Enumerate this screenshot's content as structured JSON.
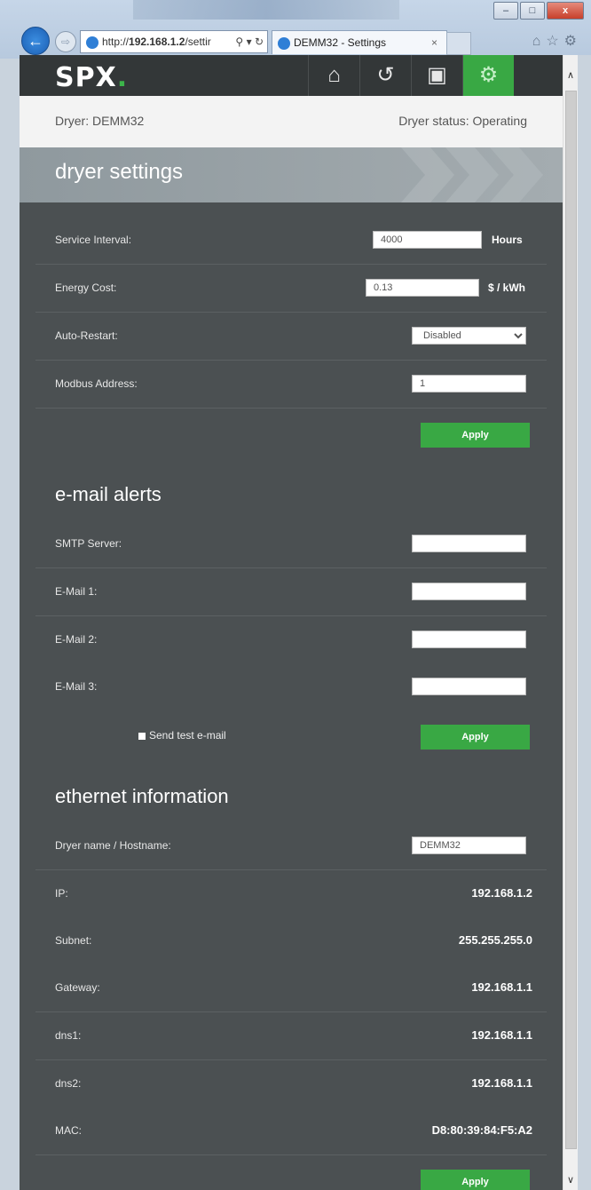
{
  "browser": {
    "url": "http://192.168.1.2/settir",
    "url_prefix": "http://",
    "url_host": "192.168.1.2",
    "url_path": "/settir",
    "tab_title": "DEMM32 - Settings",
    "tab_close": "×",
    "minimize": "–",
    "maximize": "□",
    "close": "x"
  },
  "app": {
    "logo": "SPX",
    "logo_dot": ".",
    "nav_icons": [
      "home-icon",
      "history-icon",
      "calendar-icon",
      "gear-icon"
    ],
    "accent": "#39a844"
  },
  "status": {
    "dryer_label": "Dryer: DEMM32",
    "status_label": "Dryer status: Operating"
  },
  "dryer_settings": {
    "title": "dryer settings",
    "service_interval": {
      "label": "Service Interval:",
      "value": "4000",
      "unit": "Hours"
    },
    "energy_cost": {
      "label": "Energy Cost:",
      "value": "0.13",
      "unit": "$ / kWh"
    },
    "auto_restart": {
      "label": "Auto-Restart:",
      "value": "Disabled"
    },
    "modbus_address": {
      "label": "Modbus Address:",
      "value": "1"
    },
    "apply": "Apply"
  },
  "email_alerts": {
    "title": "e-mail alerts",
    "smtp": {
      "label": "SMTP Server:",
      "value": ""
    },
    "email1": {
      "label": "E-Mail 1:",
      "value": ""
    },
    "email2": {
      "label": "E-Mail 2:",
      "value": ""
    },
    "email3": {
      "label": "E-Mail 3:",
      "value": ""
    },
    "send_test": "Send test e-mail",
    "apply": "Apply"
  },
  "ethernet": {
    "title": "ethernet information",
    "hostname": {
      "label": "Dryer name / Hostname:",
      "value": "DEMM32"
    },
    "ip": {
      "label": "IP:",
      "value": "192.168.1.2"
    },
    "subnet": {
      "label": "Subnet:",
      "value": "255.255.255.0"
    },
    "gateway": {
      "label": "Gateway:",
      "value": "192.168.1.1"
    },
    "dns1": {
      "label": "dns1:",
      "value": "192.168.1.1"
    },
    "dns2": {
      "label": "dns2:",
      "value": "192.168.1.1"
    },
    "mac": {
      "label": "MAC:",
      "value": "D8:80:39:84:F5:A2"
    },
    "apply": "Apply"
  }
}
